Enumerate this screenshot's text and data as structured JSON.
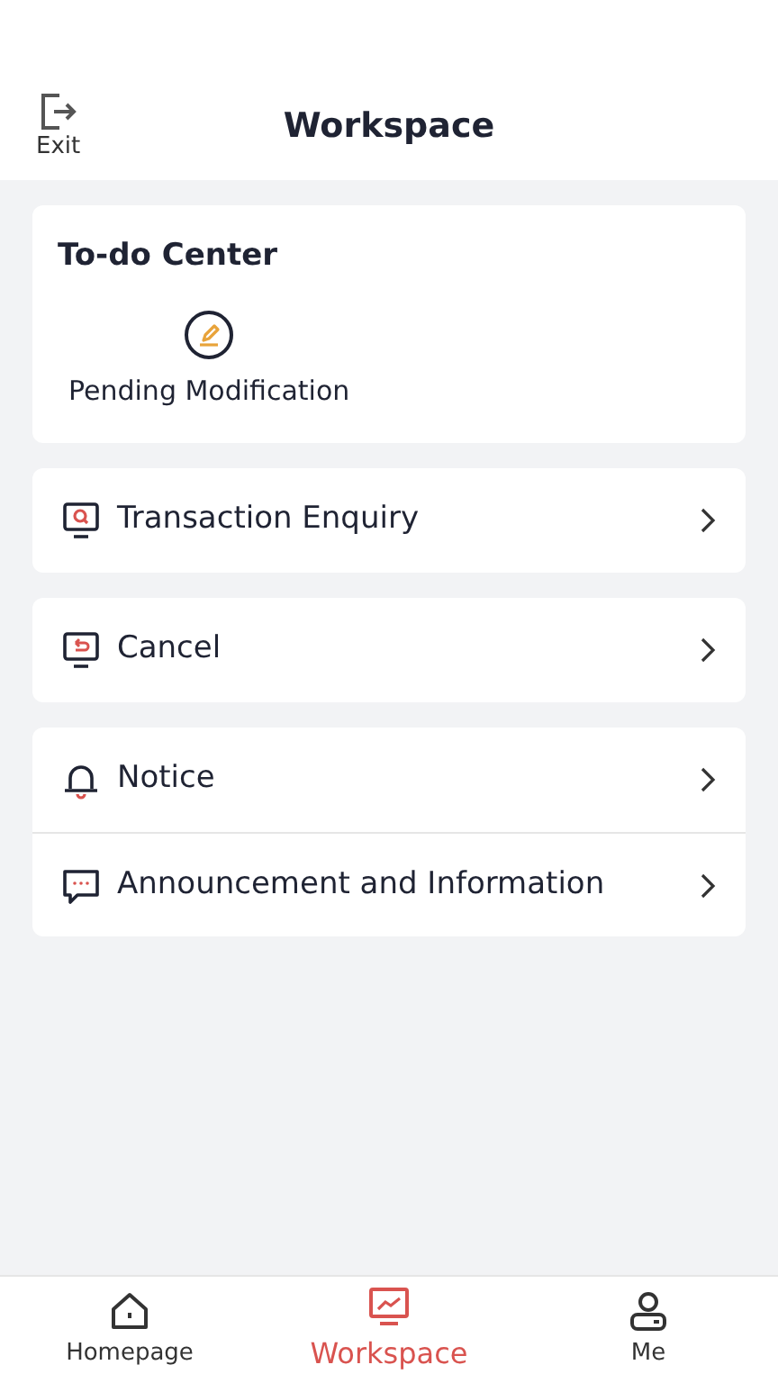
{
  "header": {
    "exit_label": "Exit",
    "title": "Workspace"
  },
  "todo": {
    "title": "To-do Center",
    "items": [
      {
        "label": "Pending Modification"
      }
    ]
  },
  "menu_groups": [
    {
      "items": [
        {
          "kind": "enquiry",
          "label": "Transaction Enquiry"
        }
      ]
    },
    {
      "items": [
        {
          "kind": "cancel",
          "label": "Cancel"
        }
      ]
    },
    {
      "items": [
        {
          "kind": "notice",
          "label": "Notice"
        },
        {
          "kind": "announcement",
          "label": "Announcement and Information"
        }
      ]
    }
  ],
  "tabs": [
    {
      "kind": "home",
      "label": "Homepage",
      "selected": false
    },
    {
      "kind": "workspace",
      "label": "Workspace",
      "selected": true
    },
    {
      "kind": "me",
      "label": "Me",
      "selected": false
    }
  ]
}
